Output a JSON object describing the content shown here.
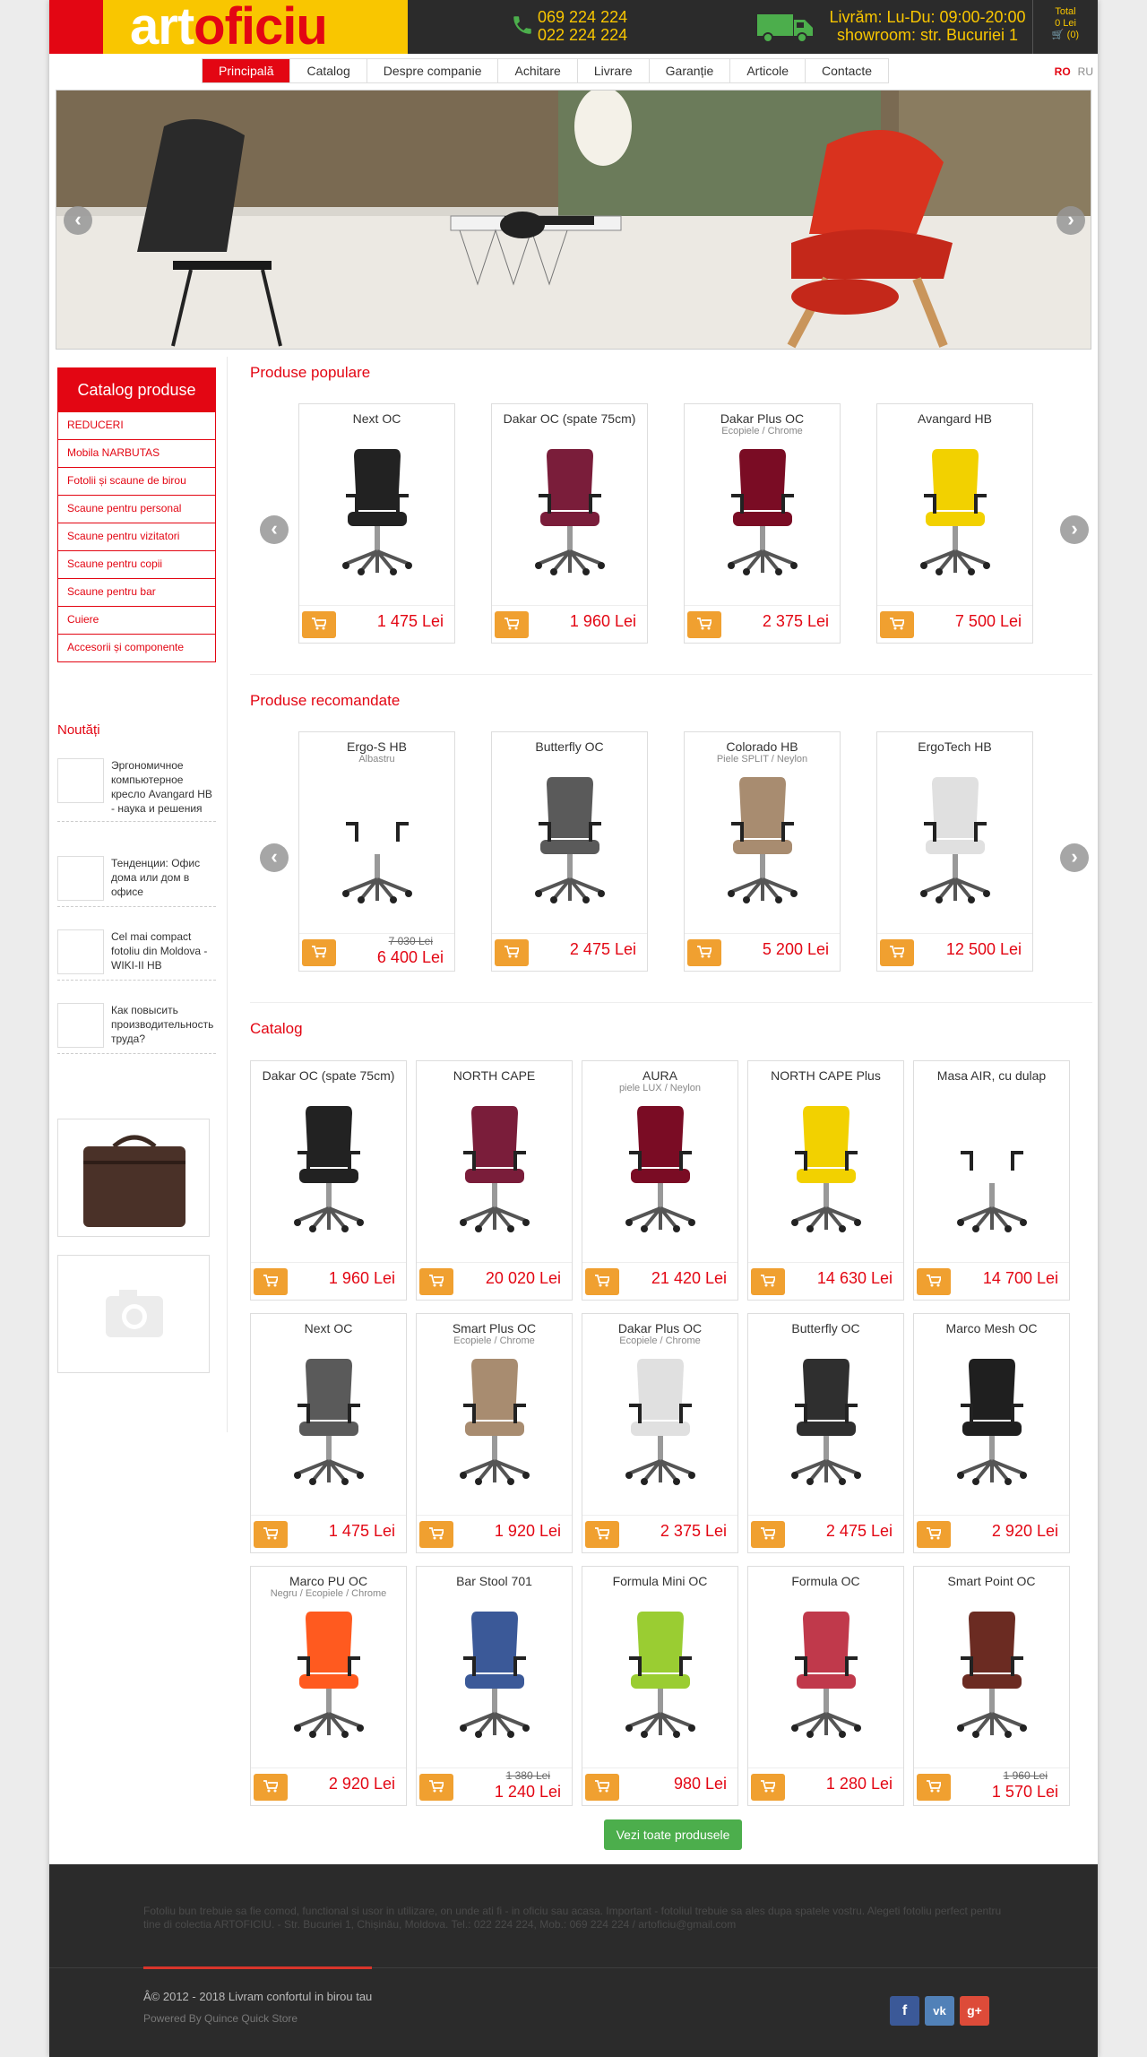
{
  "header": {
    "logo_part1": "art",
    "logo_part2": "oficiu",
    "phone1": "069 224 224",
    "phone2": "022 224 224",
    "delivery1": "Livrăm: Lu-Du: 09:00-20:00",
    "delivery2": "showroom: str. Bucuriei 1",
    "cart_total_label": "Total",
    "cart_total": "0 Lei",
    "cart_count": "(0)",
    "icons": {
      "phone": "phone-icon",
      "truck": "truck-icon",
      "cart": "cart-icon"
    }
  },
  "nav": {
    "items": [
      "Principală",
      "Catalog",
      "Despre companie",
      "Achitare",
      "Livrare",
      "Garanție",
      "Articole",
      "Contacte"
    ],
    "active": "Principală",
    "lang_ro": "RO",
    "lang_ru": "RU"
  },
  "sidebar": {
    "catalog_title": "Catalog produse",
    "categories": [
      "REDUCERI",
      "Mobila NARBUTAS",
      "Fotolii și scaune de birou",
      "Scaune pentru personal",
      "Scaune pentru vizitatori",
      "Scaune pentru copii",
      "Scaune pentru bar",
      "Cuiere",
      "Accesorii și componente"
    ],
    "news_title": "Noutăți",
    "news": [
      "Эргономичное компьютерное кресло Avangard HB - наука и решения",
      "Тенденции: Офис дома или дом в офисе",
      "Cel mai compact fotoliu din Moldova - WIKI-II HB",
      "Как повысить производительность труда?"
    ]
  },
  "popular": {
    "title": "Produse populare",
    "products": [
      {
        "name": "Next OC",
        "sub": "",
        "price": "1 475 Lei",
        "old": ""
      },
      {
        "name": "Dakar OC (spate 75cm)",
        "sub": "",
        "price": "1 960 Lei",
        "old": ""
      },
      {
        "name": "Dakar Plus OC",
        "sub": "Ecopiele / Chrome",
        "price": "2 375 Lei",
        "old": ""
      },
      {
        "name": "Avangard HB",
        "sub": "",
        "price": "7 500 Lei",
        "old": ""
      }
    ]
  },
  "recommended": {
    "title": "Produse recomandate",
    "products": [
      {
        "name": "Ergo-S HB",
        "sub": "Albastru",
        "price": "6 400 Lei",
        "old": "7 030 Lei"
      },
      {
        "name": "Butterfly OC",
        "sub": "",
        "price": "2 475 Lei",
        "old": ""
      },
      {
        "name": "Colorado HB",
        "sub": "Piele SPLIT / Neylon",
        "price": "5 200 Lei",
        "old": ""
      },
      {
        "name": "ErgoTech HB",
        "sub": "",
        "price": "12 500 Lei",
        "old": ""
      }
    ]
  },
  "catalog": {
    "title": "Catalog",
    "products": [
      {
        "name": "Dakar OC (spate 75cm)",
        "sub": "",
        "price": "1 960 Lei",
        "old": ""
      },
      {
        "name": "NORTH CAPE",
        "sub": "",
        "price": "20 020 Lei",
        "old": ""
      },
      {
        "name": "AURA",
        "sub": "piele LUX / Neylon",
        "price": "21 420 Lei",
        "old": ""
      },
      {
        "name": "NORTH CAPE Plus",
        "sub": "",
        "price": "14 630 Lei",
        "old": ""
      },
      {
        "name": "Masa AIR, cu dulap",
        "sub": "",
        "price": "14 700 Lei",
        "old": ""
      },
      {
        "name": "Next OC",
        "sub": "",
        "price": "1 475 Lei",
        "old": ""
      },
      {
        "name": "Smart Plus OC",
        "sub": "Ecopiele / Chrome",
        "price": "1 920 Lei",
        "old": ""
      },
      {
        "name": "Dakar Plus OC",
        "sub": "Ecopiele / Chrome",
        "price": "2 375 Lei",
        "old": ""
      },
      {
        "name": "Butterfly OC",
        "sub": "",
        "price": "2 475 Lei",
        "old": ""
      },
      {
        "name": "Marco Mesh OC",
        "sub": "",
        "price": "2 920 Lei",
        "old": ""
      },
      {
        "name": "Marco PU OC",
        "sub": "Negru / Ecopiele / Chrome",
        "price": "2 920 Lei",
        "old": ""
      },
      {
        "name": "Bar Stool 701",
        "sub": "",
        "price": "1 240 Lei",
        "old": "1 380 Lei"
      },
      {
        "name": "Formula Mini OC",
        "sub": "",
        "price": "980 Lei",
        "old": ""
      },
      {
        "name": "Formula OC",
        "sub": "",
        "price": "1 280 Lei",
        "old": ""
      },
      {
        "name": "Smart Point OC",
        "sub": "",
        "price": "1 570 Lei",
        "old": "1 960 Lei"
      }
    ],
    "see_all": "Vezi toate produsele"
  },
  "footer": {
    "text": "Fotoliu bun trebuie sa fie comod, functional si usor in utilizare, on unde ati fi - in oficiu sau acasa. Important - fotoliul trebuie sa ales dupa spatele vostru. Alegeti fotoliu perfect pentru tine di colectia ARTOFICIU. - Str. Bucuriei 1, Chișinău, Moldova. Tel.: 022 224 224, Mob.: 069 224 224 / artoficiu@gmail.com",
    "copyright": "Â© 2012 - 2018 Livram confortul in birou tau",
    "powered": "Powered By Quince Quick Store",
    "social": [
      "f",
      "vk",
      "g+"
    ]
  },
  "colors": {
    "brand_red": "#e30613",
    "brand_yellow": "#f9c600",
    "cart_orange": "#f0a030",
    "dark": "#2b2b2b",
    "green_button": "#4cae4c"
  }
}
